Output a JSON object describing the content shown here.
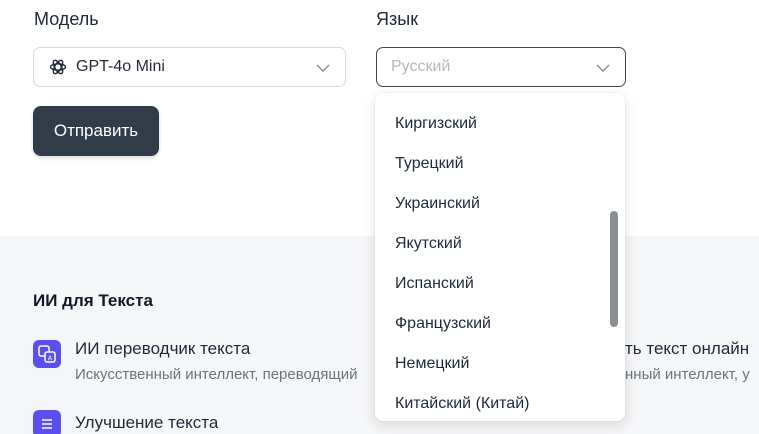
{
  "form": {
    "model_label": "Модель",
    "model_value": "GPT-4o Mini",
    "language_label": "Язык",
    "language_placeholder": "Русский",
    "submit_label": "Отправить"
  },
  "language_dropdown": {
    "options": [
      "Киргизский",
      "Турецкий",
      "Украинский",
      "Якутский",
      "Испанский",
      "Французский",
      "Немецкий",
      "Китайский (Китай)"
    ]
  },
  "text_tools": {
    "section_title": "ИИ для Текста",
    "items": [
      {
        "title": "ИИ переводчик текста",
        "description": "Искусственный интеллект, переводящий",
        "icon": "translate-icon"
      },
      {
        "title": "Улучшение текста",
        "icon": "list-icon"
      },
      {
        "title": "ть текст онлайн",
        "description": "нный интеллект, у"
      }
    ]
  },
  "colors": {
    "accent": "#5b4ef0",
    "button": "#313c4a",
    "section_bg": "#f5f6f8"
  }
}
